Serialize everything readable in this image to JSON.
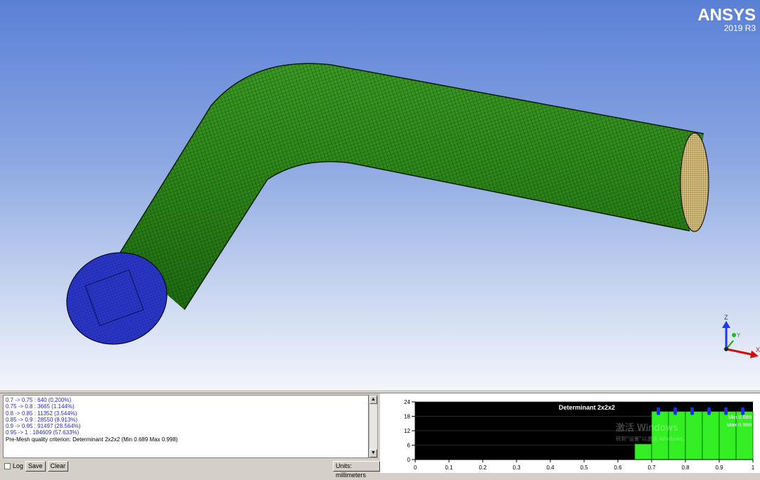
{
  "brand": {
    "name": "ANSYS",
    "version": "2019 R3"
  },
  "triad": {
    "z": "Z",
    "y": "Y",
    "x": "X"
  },
  "colors": {
    "mesh_body": "#2f8a1b",
    "mesh_line": "#0c2a08",
    "inlet_face": "#2a36c8",
    "outlet_face": "#d8c080",
    "histogram_bar": "#33ee22",
    "histogram_bg": "#000000"
  },
  "console": {
    "lines": [
      "0.7 -> 0.75 : 640 (0.200%)",
      "0.75 -> 0.8 : 3665 (1.144%)",
      "0.8 -> 0.85 : 11352 (3.544%)",
      "0.85 -> 0.9 : 28550 (8.913%)",
      "0.9 -> 0.95 : 91497 (28.564%)",
      "0.95 -> 1 : 184609 (57.633%)"
    ],
    "summary": "Pre-Mesh quality criterion: Determinant 2x2x2 (Min 0.689 Max 0.998)",
    "log_label": "Log",
    "save_label": "Save",
    "clear_label": "Clear",
    "units_label": "Units: millimeters"
  },
  "watermark": {
    "line1": "激活 Windows",
    "line2": "转到\"设置\"以激活 Windows。"
  },
  "chart_data": {
    "type": "bar",
    "title": "Determinant 2x2x2",
    "xlabel": "",
    "ylabel": "",
    "xlim": [
      0,
      1.0
    ],
    "ylim": [
      0,
      24
    ],
    "x_ticks": [
      "0",
      "0.1",
      "0.2",
      "0.3",
      "0.4",
      "0.5",
      "0.6",
      "0.7",
      "0.8",
      "0.9",
      "1"
    ],
    "y_ticks": [
      "0",
      "6",
      "12",
      "18",
      "24"
    ],
    "bins": [
      {
        "from": 0.65,
        "to": 0.7,
        "value": 6.5
      },
      {
        "from": 0.7,
        "to": 0.75,
        "value": 20
      },
      {
        "from": 0.75,
        "to": 0.8,
        "value": 20
      },
      {
        "from": 0.8,
        "to": 0.85,
        "value": 20
      },
      {
        "from": 0.85,
        "to": 0.9,
        "value": 20
      },
      {
        "from": 0.9,
        "to": 0.95,
        "value": 20
      },
      {
        "from": 0.95,
        "to": 1.0,
        "value": 20
      }
    ],
    "markers": [
      0.72,
      0.77,
      0.82,
      0.87,
      0.92,
      0.97
    ],
    "annotations": {
      "min": "Min 0.689",
      "max": "Max 0.998"
    },
    "grid": true
  }
}
